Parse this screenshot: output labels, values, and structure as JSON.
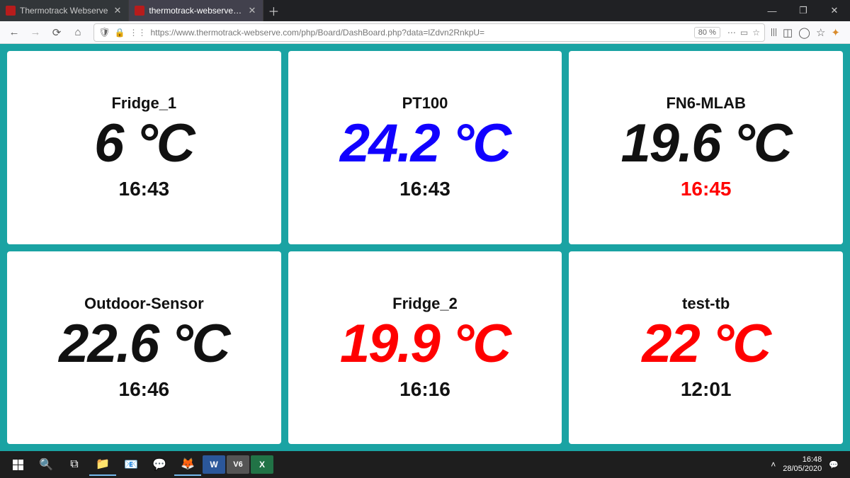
{
  "browser": {
    "tabs": [
      {
        "label": "Thermotrack Webserve",
        "active": false
      },
      {
        "label": "thermotrack-webserve.com/ph",
        "active": true
      }
    ],
    "url": "https://www.thermotrack-webserve.com/php/Board/DashBoard.php?data=lZdvn2RnkpU=",
    "zoom": "80 %"
  },
  "cards": [
    {
      "name": "Fridge_1",
      "value": "6 °C",
      "value_color": "c-black",
      "time": "16:43",
      "time_color": "c-black"
    },
    {
      "name": "PT100",
      "value": "24.2 °C",
      "value_color": "c-blue",
      "time": "16:43",
      "time_color": "c-black"
    },
    {
      "name": "FN6-MLAB",
      "value": "19.6 °C",
      "value_color": "c-black",
      "time": "16:45",
      "time_color": "c-red"
    },
    {
      "name": "Outdoor-Sensor",
      "value": "22.6 °C",
      "value_color": "c-black",
      "time": "16:46",
      "time_color": "c-black"
    },
    {
      "name": "Fridge_2",
      "value": "19.9 °C",
      "value_color": "c-red",
      "time": "16:16",
      "time_color": "c-black"
    },
    {
      "name": "test-tb",
      "value": "22 °C",
      "value_color": "c-red",
      "time": "12:01",
      "time_color": "c-black"
    }
  ],
  "system": {
    "clock": "16:48",
    "date": "28/05/2020"
  }
}
